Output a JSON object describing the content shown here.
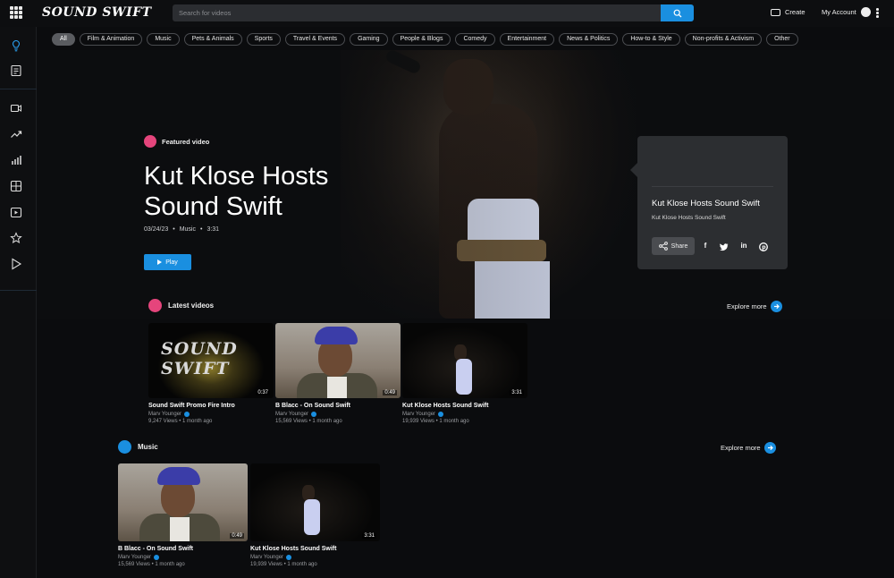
{
  "app": {
    "logo": "SOUND SWIFT"
  },
  "search": {
    "placeholder": "Search for videos"
  },
  "header": {
    "create_label": "Create",
    "account_label": "My Account"
  },
  "categories": [
    "All",
    "Film & Animation",
    "Music",
    "Pets & Animals",
    "Sports",
    "Travel & Events",
    "Gaming",
    "People & Blogs",
    "Comedy",
    "Entertainment",
    "News & Politics",
    "How-to & Style",
    "Non-profits & Activism",
    "Other"
  ],
  "active_category": "All",
  "sidebar": {
    "icons": [
      "home-icon",
      "playlist-icon",
      "video-camera-icon",
      "trending-icon",
      "chart-icon",
      "categories-icon",
      "live-icon",
      "star-icon",
      "play-store-icon"
    ]
  },
  "featured": {
    "label": "Featured video",
    "title": "Kut Klose Hosts Sound Swift",
    "date": "03/24/23",
    "category": "Music",
    "duration": "3:31",
    "play_label": "Play"
  },
  "info_card": {
    "title": "Kut Klose Hosts Sound Swift",
    "subtitle": "Kut Klose Hosts Sound Swift",
    "share_label": "Share",
    "socials": [
      "facebook-icon",
      "twitter-icon",
      "linkedin-icon",
      "pinterest-icon"
    ]
  },
  "latest": {
    "heading": "Latest videos",
    "explore_label": "Explore more",
    "videos": [
      {
        "title": "Sound Swift Promo Fire Intro",
        "author": "Marv Younger",
        "stats": "9,247 Views • 1 month ago",
        "duration": "0:37",
        "thumb_text": "SOUND SWIFT"
      },
      {
        "title": "B Blacc - On Sound Swift",
        "author": "Marv Younger",
        "stats": "15,569 Views • 1 month ago",
        "duration": "0:49"
      },
      {
        "title": "Kut Klose Hosts Sound Swift",
        "author": "Marv Younger",
        "stats": "19,939 Views • 1 month ago",
        "duration": "3:31"
      }
    ]
  },
  "music": {
    "heading": "Music",
    "explore_label": "Explore more",
    "videos": [
      {
        "title": "B Blacc - On Sound Swift",
        "author": "Marv Younger",
        "stats": "15,569 Views • 1 month ago",
        "duration": "0:49"
      },
      {
        "title": "Kut Klose Hosts Sound Swift",
        "author": "Marv Younger",
        "stats": "19,939 Views • 1 month ago",
        "duration": "3:31"
      }
    ]
  },
  "colors": {
    "accent": "#1a8fe0",
    "featured_badge": "#e5457c",
    "background": "#0b0c0e",
    "card_bg": "#2c2e31"
  }
}
